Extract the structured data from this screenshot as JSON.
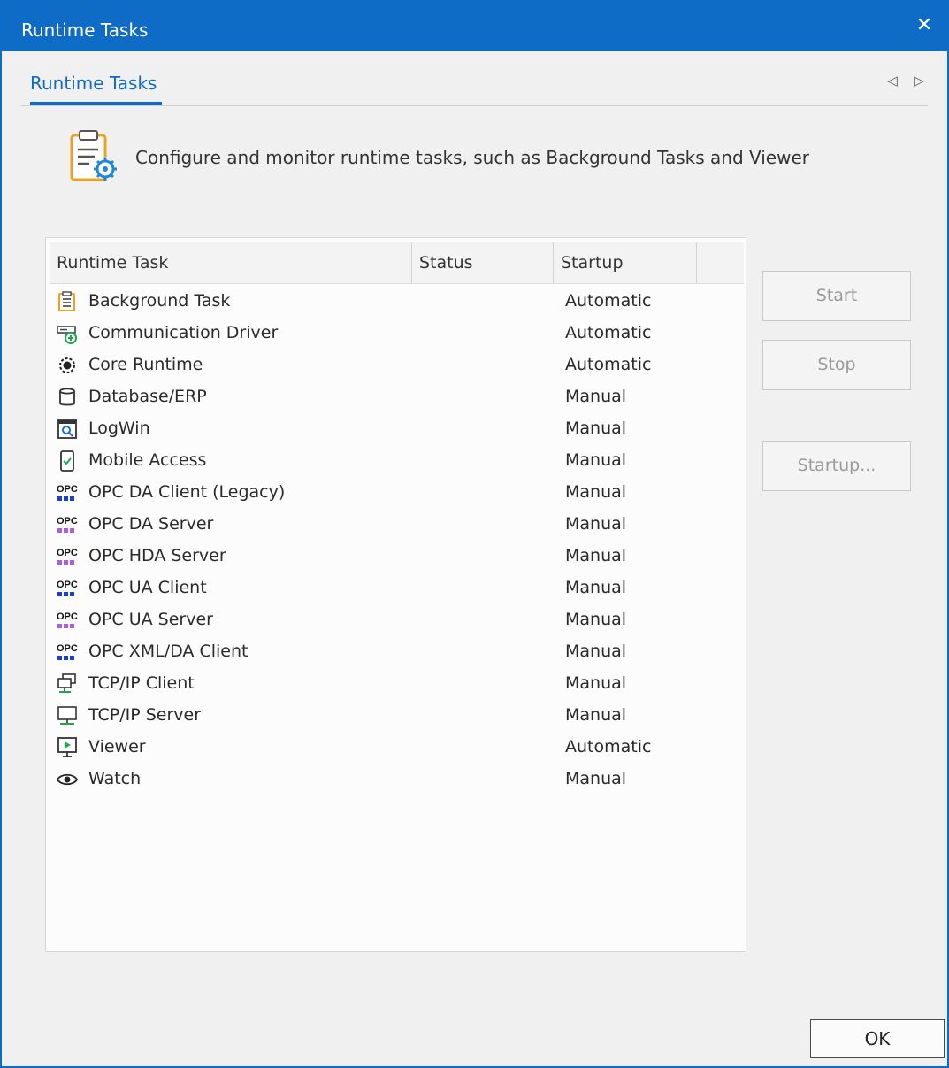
{
  "window": {
    "title": "Runtime Tasks",
    "close_glyph": "✕"
  },
  "tabs": [
    {
      "label": "Runtime Tasks",
      "active": true
    }
  ],
  "tab_nav": {
    "prev_glyph": "◁",
    "next_glyph": "▷"
  },
  "header": {
    "icon": "clipboard-gear-icon",
    "description": "Configure and monitor runtime tasks, such as Background Tasks and Viewer"
  },
  "table": {
    "columns": [
      "Runtime Task",
      "Status",
      "Startup"
    ],
    "rows": [
      {
        "icon": "clipboard-list-icon",
        "name": "Background Task",
        "status": "",
        "startup": "Automatic"
      },
      {
        "icon": "driver-icon",
        "name": "Communication Driver",
        "status": "",
        "startup": "Automatic"
      },
      {
        "icon": "gear-core-icon",
        "name": "Core Runtime",
        "status": "",
        "startup": "Automatic"
      },
      {
        "icon": "database-icon",
        "name": "Database/ERP",
        "status": "",
        "startup": "Manual"
      },
      {
        "icon": "log-window-icon",
        "name": "LogWin",
        "status": "",
        "startup": "Manual"
      },
      {
        "icon": "mobile-icon",
        "name": "Mobile Access",
        "status": "",
        "startup": "Manual"
      },
      {
        "icon": "opc-blue-icon",
        "name": "OPC DA Client (Legacy)",
        "status": "",
        "startup": "Manual"
      },
      {
        "icon": "opc-purple-icon",
        "name": "OPC DA Server",
        "status": "",
        "startup": "Manual"
      },
      {
        "icon": "opc-purple-icon",
        "name": "OPC HDA Server",
        "status": "",
        "startup": "Manual"
      },
      {
        "icon": "opc-blue-icon",
        "name": "OPC UA Client",
        "status": "",
        "startup": "Manual"
      },
      {
        "icon": "opc-purple-icon",
        "name": "OPC UA Server",
        "status": "",
        "startup": "Manual"
      },
      {
        "icon": "opc-blue-icon",
        "name": "OPC XML/DA Client",
        "status": "",
        "startup": "Manual"
      },
      {
        "icon": "network-client-icon",
        "name": "TCP/IP Client",
        "status": "",
        "startup": "Manual"
      },
      {
        "icon": "network-server-icon",
        "name": "TCP/IP Server",
        "status": "",
        "startup": "Manual"
      },
      {
        "icon": "viewer-icon",
        "name": "Viewer",
        "status": "",
        "startup": "Automatic"
      },
      {
        "icon": "eye-icon",
        "name": "Watch",
        "status": "",
        "startup": "Manual"
      }
    ]
  },
  "buttons": {
    "start": "Start",
    "stop": "Stop",
    "startup": "Startup...",
    "ok": "OK"
  },
  "opc_label": "OPC",
  "colors": {
    "accent": "#0e6cc7",
    "opc_blue": "#1a3fd8",
    "opc_purple": "#b05be0",
    "icon_orange": "#f0a020",
    "icon_green": "#1ea84a"
  }
}
